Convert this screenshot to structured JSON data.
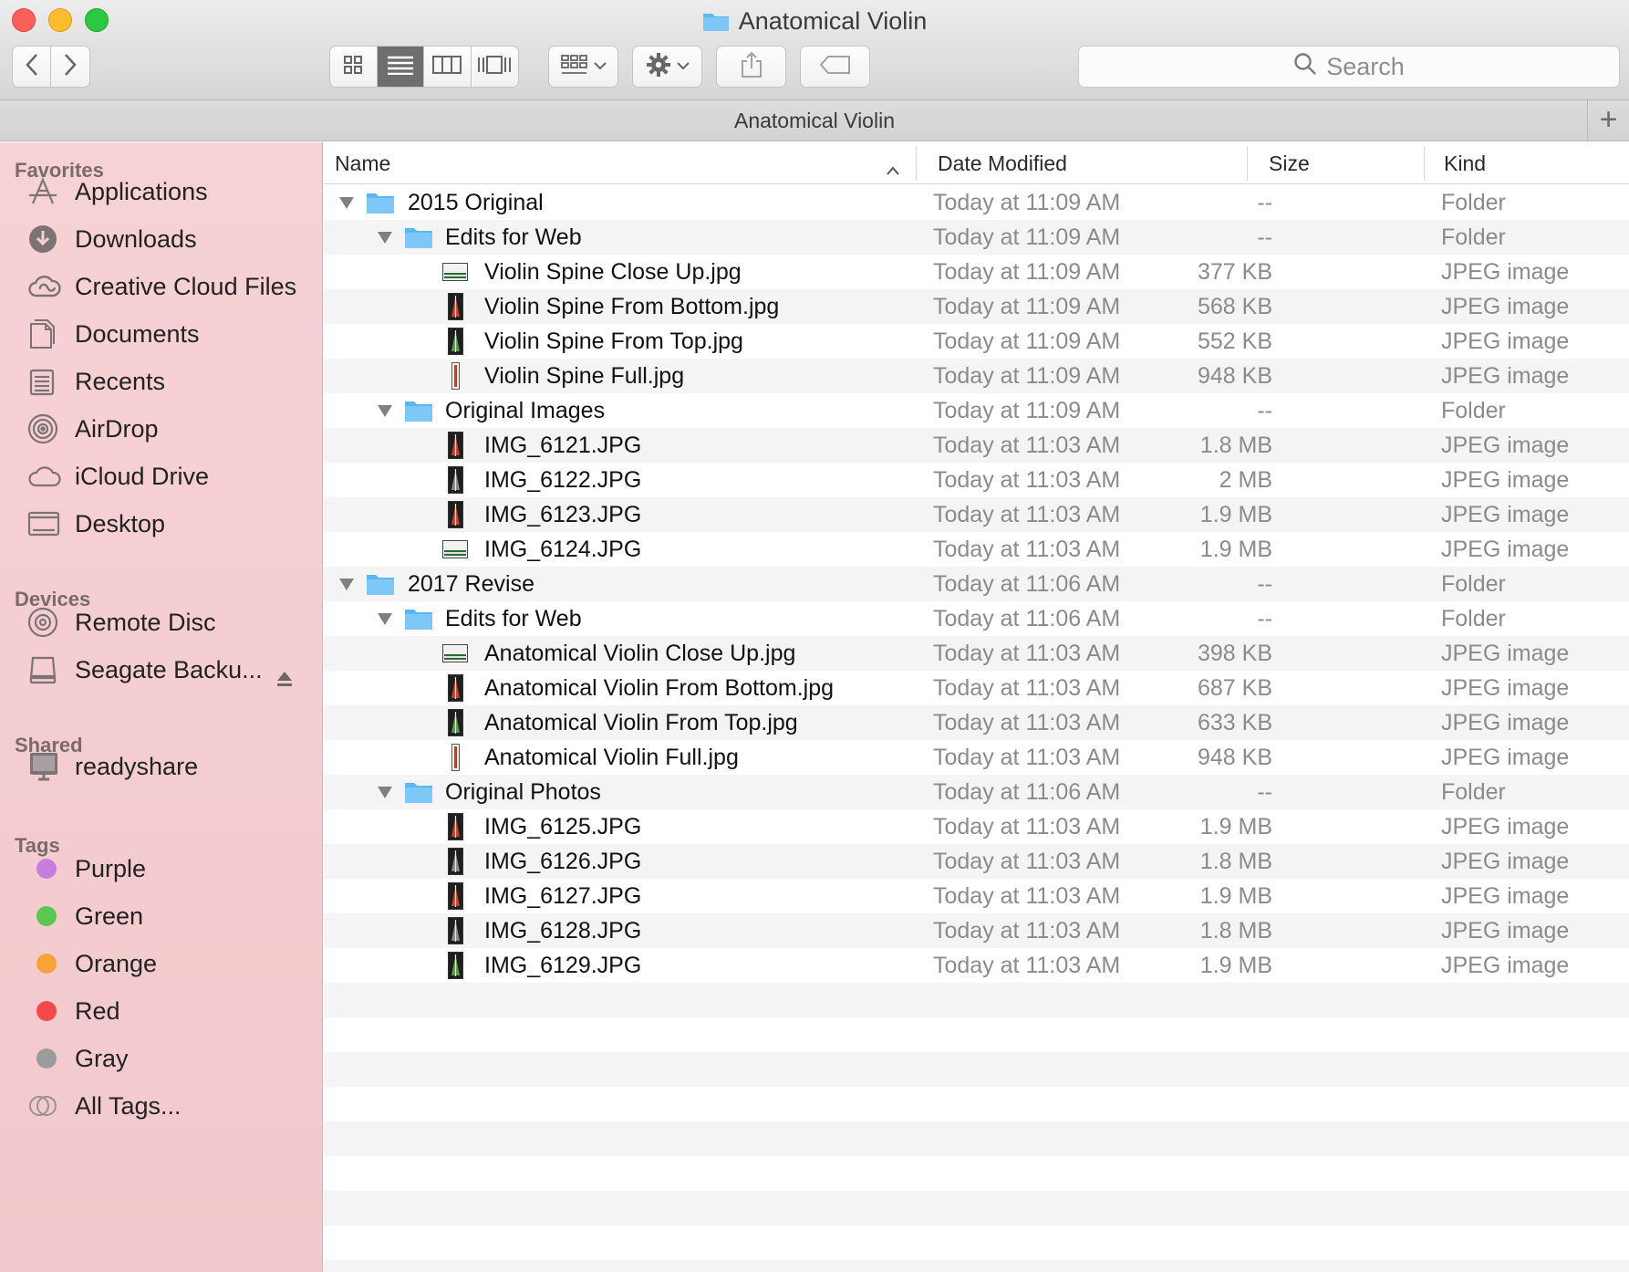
{
  "window": {
    "title": "Anatomical Violin",
    "path_title": "Anatomical Violin",
    "new_tab_glyph": "+"
  },
  "toolbar": {
    "back_icon": "chevron-left-icon",
    "forward_icon": "chevron-right-icon",
    "view_modes": [
      "icon-view",
      "list-view",
      "column-view",
      "cover-flow-view"
    ],
    "active_view": "list-view",
    "search_placeholder": "Search"
  },
  "sidebar": {
    "favorites_header": "Favorites",
    "favorites": [
      {
        "label": "Applications",
        "icon": "applications-icon"
      },
      {
        "label": "Downloads",
        "icon": "downloads-icon"
      },
      {
        "label": "Creative Cloud Files",
        "icon": "creative-cloud-icon"
      },
      {
        "label": "Documents",
        "icon": "documents-icon"
      },
      {
        "label": "Recents",
        "icon": "recents-icon"
      },
      {
        "label": "AirDrop",
        "icon": "airdrop-icon"
      },
      {
        "label": "iCloud Drive",
        "icon": "icloud-icon"
      },
      {
        "label": "Desktop",
        "icon": "desktop-icon"
      }
    ],
    "devices_header": "Devices",
    "devices": [
      {
        "label": "Remote Disc",
        "icon": "disc-icon"
      },
      {
        "label": "Seagate Backu...",
        "icon": "drive-icon"
      }
    ],
    "shared_header": "Shared",
    "shared": [
      {
        "label": "readyshare",
        "icon": "server-icon"
      }
    ],
    "tags_header": "Tags",
    "tags": [
      {
        "label": "Purple",
        "color": "#c77de0"
      },
      {
        "label": "Green",
        "color": "#5ac84f"
      },
      {
        "label": "Orange",
        "color": "#f7a23b"
      },
      {
        "label": "Red",
        "color": "#f4484b"
      },
      {
        "label": "Gray",
        "color": "#9b9b9b"
      },
      {
        "label": "All Tags...",
        "color": "all"
      }
    ]
  },
  "columns": {
    "name": "Name",
    "date": "Date Modified",
    "size": "Size",
    "kind": "Kind"
  },
  "rows": [
    {
      "name": "2015 Original",
      "depth": 0,
      "type": "folder",
      "date": "Today at 11:09 AM",
      "size": "--",
      "kind": "Folder"
    },
    {
      "name": "Edits for Web",
      "depth": 1,
      "type": "folder",
      "date": "Today at 11:09 AM",
      "size": "--",
      "kind": "Folder"
    },
    {
      "name": "Violin Spine Close Up.jpg",
      "depth": 2,
      "type": "wide",
      "date": "Today at 11:09 AM",
      "size": "377 KB",
      "kind": "JPEG image"
    },
    {
      "name": "Violin Spine From Bottom.jpg",
      "depth": 2,
      "type": "tall-red",
      "date": "Today at 11:09 AM",
      "size": "568 KB",
      "kind": "JPEG image"
    },
    {
      "name": "Violin Spine From Top.jpg",
      "depth": 2,
      "type": "tall-green",
      "date": "Today at 11:09 AM",
      "size": "552 KB",
      "kind": "JPEG image"
    },
    {
      "name": "Violin Spine Full.jpg",
      "depth": 2,
      "type": "slim",
      "date": "Today at 11:09 AM",
      "size": "948 KB",
      "kind": "JPEG image"
    },
    {
      "name": "Original Images",
      "depth": 1,
      "type": "folder",
      "date": "Today at 11:09 AM",
      "size": "--",
      "kind": "Folder"
    },
    {
      "name": "IMG_6121.JPG",
      "depth": 2,
      "type": "tall-red",
      "date": "Today at 11:03 AM",
      "size": "1.8 MB",
      "kind": "JPEG image"
    },
    {
      "name": "IMG_6122.JPG",
      "depth": 2,
      "type": "tall-gray",
      "date": "Today at 11:03 AM",
      "size": "2 MB",
      "kind": "JPEG image"
    },
    {
      "name": "IMG_6123.JPG",
      "depth": 2,
      "type": "tall-red",
      "date": "Today at 11:03 AM",
      "size": "1.9 MB",
      "kind": "JPEG image"
    },
    {
      "name": "IMG_6124.JPG",
      "depth": 2,
      "type": "wide",
      "date": "Today at 11:03 AM",
      "size": "1.9 MB",
      "kind": "JPEG image"
    },
    {
      "name": "2017 Revise",
      "depth": 0,
      "type": "folder",
      "date": "Today at 11:06 AM",
      "size": "--",
      "kind": "Folder"
    },
    {
      "name": "Edits for Web",
      "depth": 1,
      "type": "folder",
      "date": "Today at 11:06 AM",
      "size": "--",
      "kind": "Folder"
    },
    {
      "name": "Anatomical Violin Close Up.jpg",
      "depth": 2,
      "type": "wide",
      "date": "Today at 11:03 AM",
      "size": "398 KB",
      "kind": "JPEG image"
    },
    {
      "name": "Anatomical Violin From Bottom.jpg",
      "depth": 2,
      "type": "tall-red",
      "date": "Today at 11:03 AM",
      "size": "687 KB",
      "kind": "JPEG image"
    },
    {
      "name": "Anatomical Violin From Top.jpg",
      "depth": 2,
      "type": "tall-green",
      "date": "Today at 11:03 AM",
      "size": "633 KB",
      "kind": "JPEG image"
    },
    {
      "name": "Anatomical Violin Full.jpg",
      "depth": 2,
      "type": "slim",
      "date": "Today at 11:03 AM",
      "size": "948 KB",
      "kind": "JPEG image"
    },
    {
      "name": "Original Photos",
      "depth": 1,
      "type": "folder",
      "date": "Today at 11:06 AM",
      "size": "--",
      "kind": "Folder"
    },
    {
      "name": "IMG_6125.JPG",
      "depth": 2,
      "type": "tall-red",
      "date": "Today at 11:03 AM",
      "size": "1.9 MB",
      "kind": "JPEG image"
    },
    {
      "name": "IMG_6126.JPG",
      "depth": 2,
      "type": "tall-gray",
      "date": "Today at 11:03 AM",
      "size": "1.8 MB",
      "kind": "JPEG image"
    },
    {
      "name": "IMG_6127.JPG",
      "depth": 2,
      "type": "tall-red",
      "date": "Today at 11:03 AM",
      "size": "1.9 MB",
      "kind": "JPEG image"
    },
    {
      "name": "IMG_6128.JPG",
      "depth": 2,
      "type": "tall-gray",
      "date": "Today at 11:03 AM",
      "size": "1.8 MB",
      "kind": "JPEG image"
    },
    {
      "name": "IMG_6129.JPG",
      "depth": 2,
      "type": "tall-green",
      "date": "Today at 11:03 AM",
      "size": "1.9 MB",
      "kind": "JPEG image"
    }
  ]
}
